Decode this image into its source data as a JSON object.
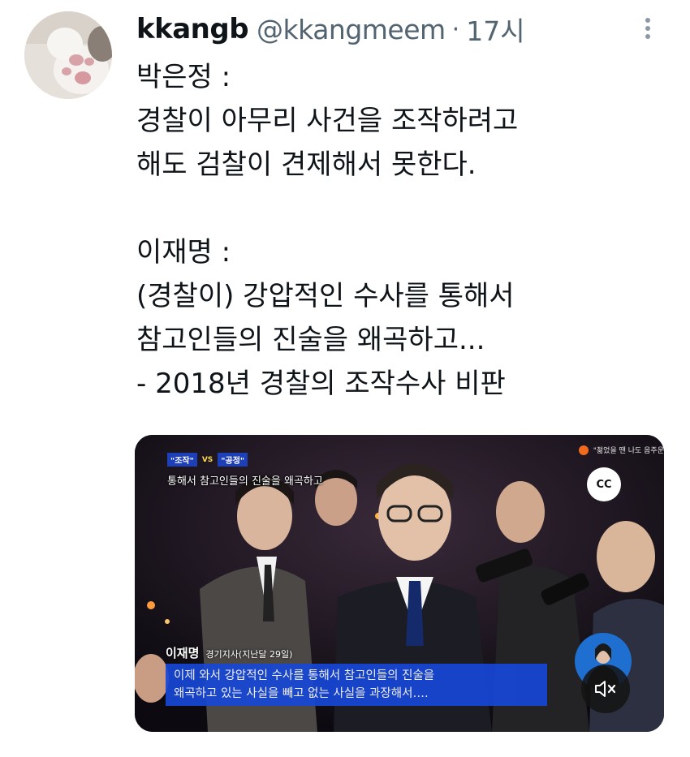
{
  "tweet": {
    "display_name": "kkangb",
    "handle": "@kkangmeem",
    "separator": "·",
    "time": "17시",
    "lines": [
      "박은정 :",
      "경찰이 아무리 사건을 조작하려고",
      "해도 검찰이 견제해서 못한다.",
      "",
      "이재명 :",
      "(경찰이) 강압적인 수사를 통해서",
      "참고인들의 진술을 왜곡하고...",
      "- 2018년 경찰의 조작수사 비판"
    ]
  },
  "media": {
    "tag_left": "\"조작\"",
    "tag_vs": "VS",
    "tag_right": "\"공정\"",
    "top_caption": "통해서 참고인들의 진술을 왜곡하고",
    "ticker_text": "\"젊었을 땐 나도 음주운",
    "cc_label": "CC",
    "speaker_name": "이재명",
    "speaker_role": "경기지사(지난달 29일)",
    "subtitle_line1": "이제 와서 강압적인 수사를 통해서 참고인들의 진술을",
    "subtitle_line2": "왜곡하고 있는 사실을 빼고 없는 사실을 과장해서…."
  },
  "icons": {
    "more": "more-vertical-icon",
    "mute": "volume-muted-icon",
    "captions": "closed-captions-icon"
  },
  "colors": {
    "text": "#0f1419",
    "secondary": "#536471",
    "subtitle_bg": "#1747d6"
  }
}
